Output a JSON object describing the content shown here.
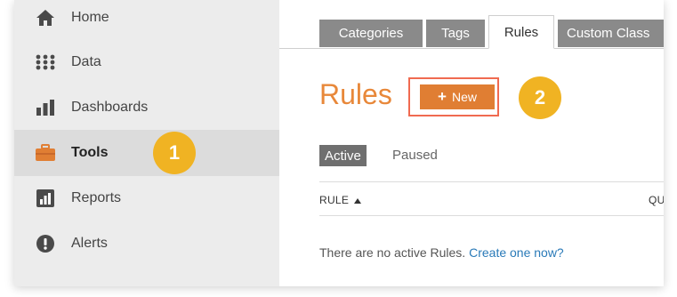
{
  "sidebar": {
    "items": [
      {
        "label": "Home",
        "icon": "home-icon"
      },
      {
        "label": "Data",
        "icon": "grid-icon"
      },
      {
        "label": "Dashboards",
        "icon": "bar-chart-icon"
      },
      {
        "label": "Tools",
        "icon": "briefcase-icon",
        "active": true
      },
      {
        "label": "Reports",
        "icon": "report-icon"
      },
      {
        "label": "Alerts",
        "icon": "alert-icon"
      }
    ]
  },
  "callouts": {
    "one": "1",
    "two": "2"
  },
  "tabs": [
    {
      "label": "Categories"
    },
    {
      "label": "Tags"
    },
    {
      "label": "Rules",
      "active": true
    },
    {
      "label": "Custom Class"
    }
  ],
  "main": {
    "title": "Rules",
    "new_button_plus": "+",
    "new_button_label": "New",
    "filters": {
      "active": "Active",
      "paused": "Paused"
    },
    "columns": {
      "rule": "RULE",
      "second": "QU"
    },
    "empty_text": "There are no active Rules.",
    "empty_link": "Create one now?"
  },
  "colors": {
    "accent": "#e8883a",
    "badge": "#f0b323",
    "highlight": "#f06a50",
    "link": "#2a7ab8",
    "sidebar_bg": "#ececec"
  }
}
